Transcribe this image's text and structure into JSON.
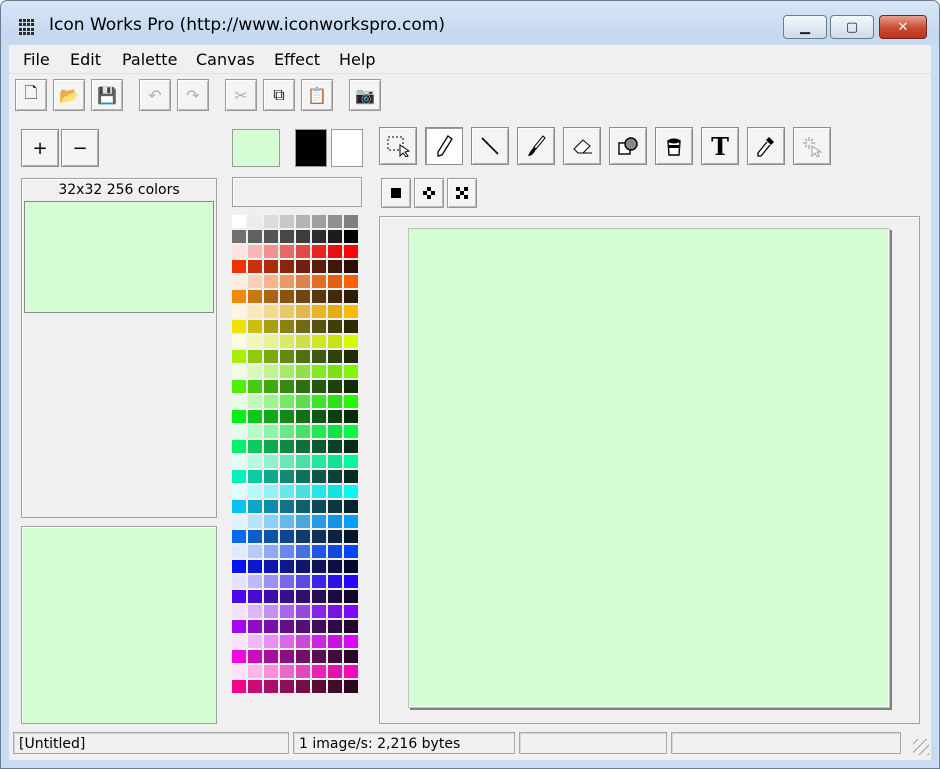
{
  "window": {
    "title": "Icon Works Pro (http://www.iconworkspro.com)"
  },
  "menu": [
    "File",
    "Edit",
    "Palette",
    "Canvas",
    "Effect",
    "Help"
  ],
  "toolbar": {
    "buttons": [
      {
        "icon": "new-file-icon",
        "glyph": "🗋",
        "enabled": true
      },
      {
        "icon": "open-folder-icon",
        "glyph": "📂",
        "enabled": true
      },
      {
        "icon": "save-disk-icon",
        "glyph": "💾",
        "enabled": true
      },
      {
        "icon": "undo-icon",
        "glyph": "↶",
        "enabled": false
      },
      {
        "icon": "redo-icon",
        "glyph": "↷",
        "enabled": false
      },
      {
        "icon": "cut-icon",
        "glyph": "✂",
        "enabled": false
      },
      {
        "icon": "copy-icon",
        "glyph": "⧉",
        "enabled": true
      },
      {
        "icon": "paste-icon",
        "glyph": "📋",
        "enabled": false
      },
      {
        "icon": "camera-icon",
        "glyph": "📷",
        "enabled": true
      }
    ]
  },
  "zoom": {
    "plus": "+",
    "minus": "−"
  },
  "preview": {
    "format_label": "32x32 256 colors"
  },
  "colors": {
    "canvas_bg": "#d4fdd4",
    "primary": "#000000",
    "secondary": "#ffffff",
    "current": "#d4fdd4"
  },
  "tools": [
    "select-icon",
    "pencil-icon",
    "line-icon",
    "brush-icon",
    "eraser-icon",
    "shapes-icon",
    "fill-bucket-icon",
    "text-icon",
    "eyedropper-icon",
    "magic-wand-icon"
  ],
  "tools_text": {
    "text_tool": "T"
  },
  "brush_sizes": [
    "brush-square-icon",
    "brush-plus-icon",
    "brush-cross-icon"
  ],
  "status": {
    "document": "[Untitled]",
    "info": "1 image/s: 2,216 bytes"
  }
}
